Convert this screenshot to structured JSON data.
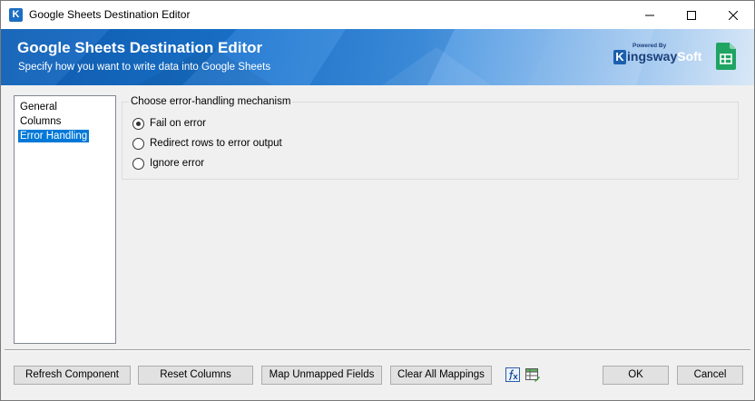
{
  "window": {
    "title": "Google Sheets Destination Editor",
    "app_icon_letter": "K"
  },
  "banner": {
    "title": "Google Sheets Destination Editor",
    "subtitle": "Specify how you want to write data into Google Sheets",
    "brand_powered": "Powered By",
    "brand_k": "K",
    "brand_name_main": "ingsway",
    "brand_name_soft": "Soft"
  },
  "nav": {
    "items": [
      {
        "label": "General",
        "selected": false
      },
      {
        "label": "Columns",
        "selected": false
      },
      {
        "label": "Error Handling",
        "selected": true
      }
    ]
  },
  "error_handling": {
    "legend": "Choose error-handling mechanism",
    "options": [
      {
        "label": "Fail on error",
        "checked": true
      },
      {
        "label": "Redirect rows to error output",
        "checked": false
      },
      {
        "label": "Ignore error",
        "checked": false
      }
    ]
  },
  "footer": {
    "refresh_label": "Refresh Component",
    "reset_label": "Reset Columns",
    "map_label": "Map Unmapped Fields",
    "clear_label": "Clear All Mappings",
    "ok_label": "OK",
    "cancel_label": "Cancel"
  },
  "colors": {
    "accent": "#0078d7",
    "banner_blue": "#1a74cf",
    "sheets_green": "#1fa463"
  },
  "icons": {
    "app": "kingswaysoft-icon",
    "sheets": "google-sheets-icon",
    "fx": "expression-fx-icon",
    "grid": "grid-edit-icon"
  }
}
